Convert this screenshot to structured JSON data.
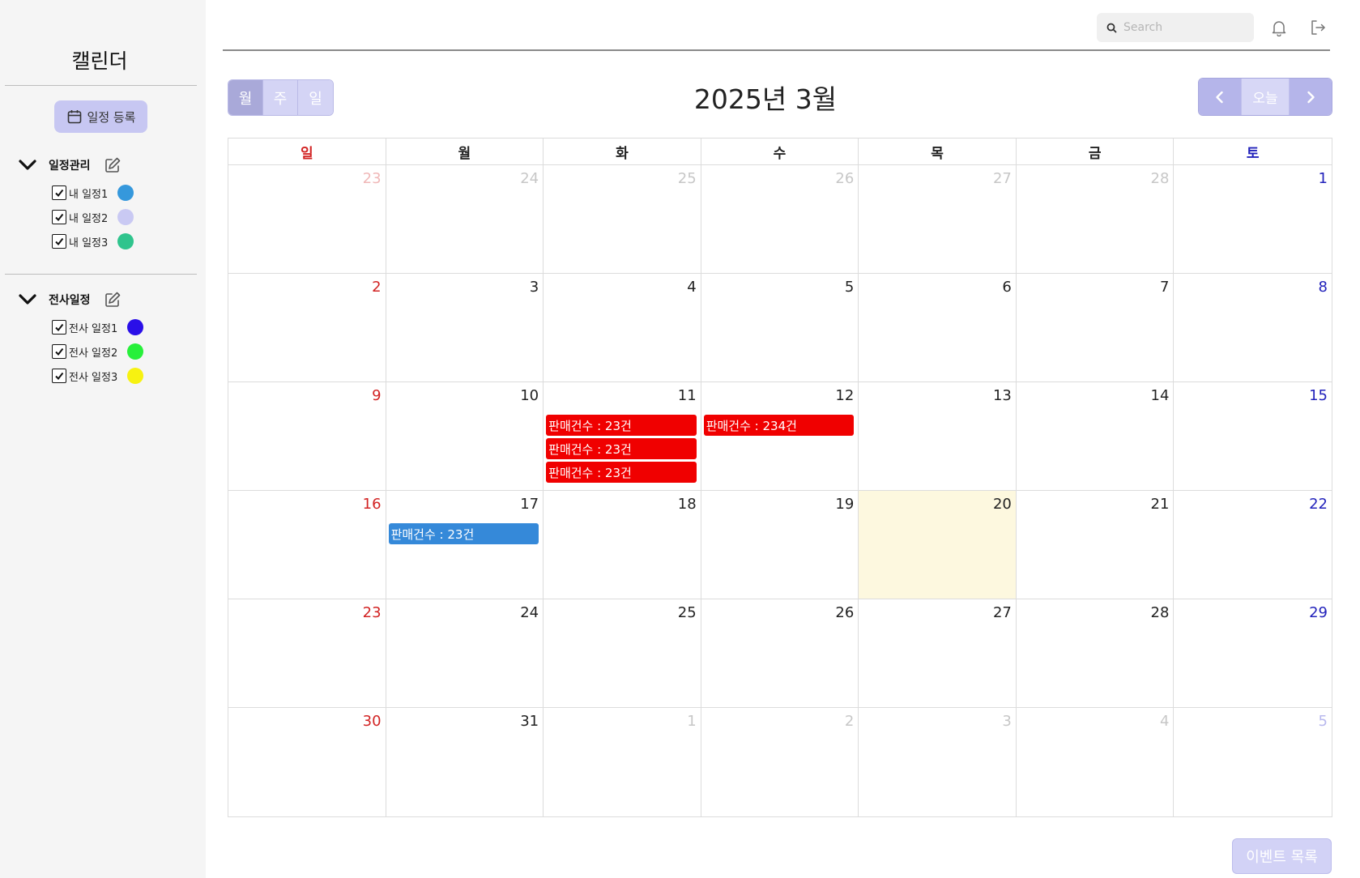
{
  "sidebar": {
    "title": "캘린더",
    "add_button_label": "일정 등록",
    "groups": [
      {
        "title": "일정관리",
        "items": [
          {
            "label": "내 일정1",
            "color": "#3598dc"
          },
          {
            "label": "내 일정2",
            "color": "#c9c9f3"
          },
          {
            "label": "내 일정3",
            "color": "#2fc48d"
          }
        ]
      },
      {
        "title": "전사일정",
        "items": [
          {
            "label": "전사 일정1",
            "color": "#2a0fe8"
          },
          {
            "label": "전사 일정2",
            "color": "#27f03a"
          },
          {
            "label": "전사 일정3",
            "color": "#f7f211"
          }
        ]
      }
    ]
  },
  "topbar": {
    "search_placeholder": "Search",
    "icons": [
      "bell-icon",
      "logout-icon"
    ]
  },
  "calendar": {
    "view_tabs": [
      "월",
      "주",
      "일"
    ],
    "active_view": "월",
    "month_title": "2025년 3월",
    "today_label": "오늘",
    "weekday_headers": [
      "일",
      "월",
      "화",
      "수",
      "목",
      "금",
      "토"
    ],
    "today_date": "20",
    "weeks": [
      [
        {
          "d": "23",
          "o": true
        },
        {
          "d": "24",
          "o": true
        },
        {
          "d": "25",
          "o": true
        },
        {
          "d": "26",
          "o": true
        },
        {
          "d": "27",
          "o": true
        },
        {
          "d": "28",
          "o": true
        },
        {
          "d": "1",
          "o": false
        }
      ],
      [
        {
          "d": "2",
          "o": false
        },
        {
          "d": "3",
          "o": false
        },
        {
          "d": "4",
          "o": false
        },
        {
          "d": "5",
          "o": false
        },
        {
          "d": "6",
          "o": false
        },
        {
          "d": "7",
          "o": false
        },
        {
          "d": "8",
          "o": false
        }
      ],
      [
        {
          "d": "9",
          "o": false
        },
        {
          "d": "10",
          "o": false
        },
        {
          "d": "11",
          "o": false,
          "events": [
            {
              "title": "판매건수 : 23건",
              "color": "#f00000"
            },
            {
              "title": "판매건수 : 23건",
              "color": "#f00000"
            },
            {
              "title": "판매건수 : 23건",
              "color": "#f00000"
            }
          ]
        },
        {
          "d": "12",
          "o": false,
          "events": [
            {
              "title": "판매건수 : 234건",
              "color": "#f00000"
            }
          ]
        },
        {
          "d": "13",
          "o": false
        },
        {
          "d": "14",
          "o": false
        },
        {
          "d": "15",
          "o": false
        }
      ],
      [
        {
          "d": "16",
          "o": false
        },
        {
          "d": "17",
          "o": false,
          "events": [
            {
              "title": "판매건수 : 23건",
              "color": "#3589d9"
            }
          ]
        },
        {
          "d": "18",
          "o": false
        },
        {
          "d": "19",
          "o": false
        },
        {
          "d": "20",
          "o": false,
          "today": true
        },
        {
          "d": "21",
          "o": false
        },
        {
          "d": "22",
          "o": false
        }
      ],
      [
        {
          "d": "23",
          "o": false
        },
        {
          "d": "24",
          "o": false
        },
        {
          "d": "25",
          "o": false
        },
        {
          "d": "26",
          "o": false
        },
        {
          "d": "27",
          "o": false
        },
        {
          "d": "28",
          "o": false
        },
        {
          "d": "29",
          "o": false
        }
      ],
      [
        {
          "d": "30",
          "o": false
        },
        {
          "d": "31",
          "o": false
        },
        {
          "d": "1",
          "o": true
        },
        {
          "d": "2",
          "o": true
        },
        {
          "d": "3",
          "o": true
        },
        {
          "d": "4",
          "o": true
        },
        {
          "d": "5",
          "o": true
        }
      ]
    ],
    "event_list_label": "이벤트 목록"
  }
}
